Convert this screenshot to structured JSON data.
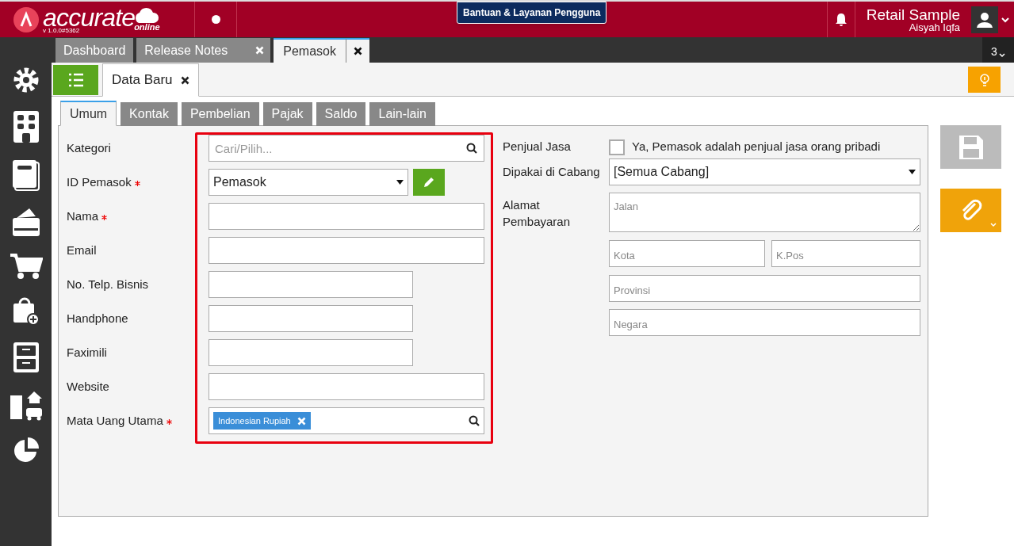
{
  "header": {
    "brand": "accurate",
    "brand_sub": "online",
    "version": "v 1.0.0#5362",
    "help_button": "Bantuan & Layanan Pengguna",
    "company": "Retail Sample",
    "user": "Aisyah Iqfa"
  },
  "doc_tabs": [
    {
      "label": "Dashboard",
      "closable": false,
      "selected": false
    },
    {
      "label": "Release Notes",
      "closable": true,
      "selected": false
    },
    {
      "label": "Pemasok",
      "closable": true,
      "selected": true
    }
  ],
  "tab_count": "3",
  "page_tabs": [
    {
      "label": "Data Baru",
      "closable": true,
      "selected": true
    }
  ],
  "form_tabs": [
    {
      "label": "Umum",
      "selected": true
    },
    {
      "label": "Kontak",
      "selected": false
    },
    {
      "label": "Pembelian",
      "selected": false
    },
    {
      "label": "Pajak",
      "selected": false
    },
    {
      "label": "Saldo",
      "selected": false
    },
    {
      "label": "Lain-lain",
      "selected": false
    }
  ],
  "left_fields": [
    {
      "label": "Kategori",
      "required": false,
      "kind": "search",
      "placeholder": "Cari/Pilih..."
    },
    {
      "label": "ID Pemasok",
      "required": true,
      "kind": "select",
      "value": "Pemasok"
    },
    {
      "label": "Nama",
      "required": true,
      "kind": "text"
    },
    {
      "label": "Email",
      "required": false,
      "kind": "text"
    },
    {
      "label": "No. Telp. Bisnis",
      "required": false,
      "kind": "short"
    },
    {
      "label": "Handphone",
      "required": false,
      "kind": "short"
    },
    {
      "label": "Faximili",
      "required": false,
      "kind": "short"
    },
    {
      "label": "Website",
      "required": false,
      "kind": "text"
    },
    {
      "label": "Mata Uang Utama",
      "required": true,
      "kind": "tags",
      "tags": [
        "Indonesian Rupiah"
      ]
    }
  ],
  "penjual_jasa": {
    "label": "Penjual Jasa",
    "checkbox_label": "Ya, Pemasok adalah penjual jasa orang pribadi",
    "checked": false
  },
  "cabang": {
    "label": "Dipakai di Cabang",
    "value": "[Semua Cabang]"
  },
  "alamat": {
    "label": "Alamat Pembayaran",
    "street_placeholder": "Jalan",
    "city_placeholder": "Kota",
    "postal_placeholder": "K.Pos",
    "province_placeholder": "Provinsi",
    "country_placeholder": "Negara"
  }
}
